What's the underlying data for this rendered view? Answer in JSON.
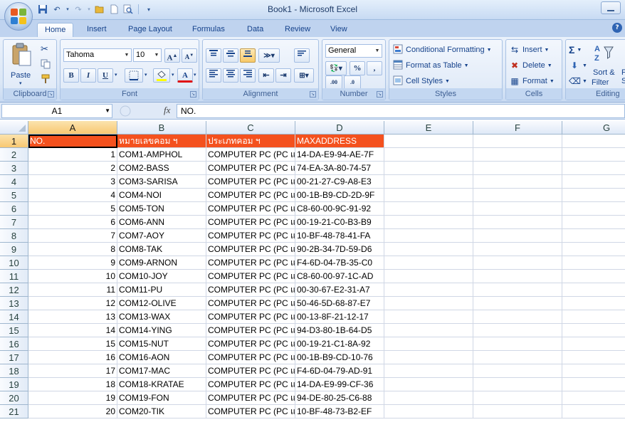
{
  "window": {
    "title": "Book1 - Microsoft Excel"
  },
  "qat": {
    "icons": [
      "save-icon",
      "undo-icon",
      "redo-icon",
      "open-icon",
      "new-icon",
      "print-preview-icon"
    ]
  },
  "tabs": [
    "Home",
    "Insert",
    "Page Layout",
    "Formulas",
    "Data",
    "Review",
    "View"
  ],
  "help": "?",
  "ribbon": {
    "clipboard": {
      "label": "Clipboard",
      "paste": "Paste"
    },
    "font": {
      "label": "Font",
      "name": "Tahoma",
      "size": "10",
      "bold": "B",
      "italic": "I",
      "underline": "U",
      "grow": "A",
      "shrink": "A",
      "font_color_letter": "A"
    },
    "alignment": {
      "label": "Alignment"
    },
    "number": {
      "label": "Number",
      "format": "General",
      "percent": "%",
      "comma": ",",
      "inc_decimal": ".00",
      "dec_decimal": ".0"
    },
    "styles": {
      "label": "Styles",
      "conditional": "Conditional Formatting",
      "format_table": "Format as Table",
      "cell_styles": "Cell Styles"
    },
    "cells": {
      "label": "Cells",
      "insert": "Insert",
      "delete": "Delete",
      "format": "Format"
    },
    "editing": {
      "label": "Editing",
      "sum": "Σ",
      "sort_filter": "Sort &",
      "sort_filter2": "Filter",
      "find": "F",
      "find2": "S"
    }
  },
  "formula_bar": {
    "name_box": "A1",
    "fx": "fx",
    "value": "NO."
  },
  "sheet": {
    "columns": [
      "A",
      "B",
      "C",
      "D",
      "E",
      "F",
      "G"
    ],
    "row_numbers": [
      "1",
      "2",
      "3",
      "4",
      "5",
      "6",
      "7",
      "8",
      "9",
      "10",
      "11",
      "12",
      "13",
      "14",
      "15",
      "16",
      "17",
      "18",
      "19",
      "20",
      "21"
    ],
    "header_row": [
      "NO.",
      "หมายเลขคอม ฯ",
      "ประเภทคอม ฯ",
      "MAXADDRESS"
    ],
    "rows": [
      [
        "1",
        "COM1-AMPHOL",
        "COMPUTER PC (PC แ",
        "14-DA-E9-94-AE-7F"
      ],
      [
        "2",
        "COM2-BASS",
        "COMPUTER PC (PC แ",
        "74-EA-3A-80-74-57"
      ],
      [
        "3",
        "COM3-SARISA",
        "COMPUTER PC (PC แ",
        "00-21-27-C9-A8-E3"
      ],
      [
        "4",
        "COM4-NOI",
        "COMPUTER PC (PC แ",
        "00-1B-B9-CD-2D-9F"
      ],
      [
        "5",
        "COM5-TON",
        "COMPUTER PC (PC แ",
        "C8-60-00-9C-91-92"
      ],
      [
        "6",
        "COM6-ANN",
        "COMPUTER PC (PC แ",
        "00-19-21-C0-B3-B9"
      ],
      [
        "7",
        "COM7-AOY",
        "COMPUTER PC (PC แ",
        "10-BF-48-78-41-FA"
      ],
      [
        "8",
        "COM8-TAK",
        "COMPUTER PC (PC แ",
        "90-2B-34-7D-59-D6"
      ],
      [
        "9",
        "COM9-ARNON",
        "COMPUTER PC (PC แ",
        "F4-6D-04-7B-35-C0"
      ],
      [
        "10",
        "COM10-JOY",
        "COMPUTER PC (PC แ",
        "C8-60-00-97-1C-AD"
      ],
      [
        "11",
        "COM11-PU",
        "COMPUTER PC (PC แ",
        "00-30-67-E2-31-A7"
      ],
      [
        "12",
        "COM12-OLIVE",
        "COMPUTER PC (PC แ",
        "50-46-5D-68-87-E7"
      ],
      [
        "13",
        "COM13-WAX",
        "COMPUTER PC (PC แ",
        "00-13-8F-21-12-17"
      ],
      [
        "14",
        "COM14-YING",
        "COMPUTER PC (PC แ",
        "94-D3-80-1B-64-D5"
      ],
      [
        "15",
        "COM15-NUT",
        "COMPUTER PC (PC แ",
        "00-19-21-C1-8A-92"
      ],
      [
        "16",
        "COM16-AON",
        "COMPUTER PC (PC แ",
        "00-1B-B9-CD-10-76"
      ],
      [
        "17",
        "COM17-MAC",
        "COMPUTER PC (PC แ",
        "F4-6D-04-79-AD-91"
      ],
      [
        "18",
        "COM18-KRATAE",
        "COMPUTER PC (PC แ",
        "14-DA-E9-99-CF-36"
      ],
      [
        "19",
        "COM19-FON",
        "COMPUTER PC (PC แ",
        "94-DE-80-25-C6-88"
      ],
      [
        "20",
        "COM20-TIK",
        "COMPUTER PC (PC แ",
        "10-BF-48-73-B2-EF"
      ]
    ],
    "header_fill": "#f4511e",
    "selection_highlight": "#f8c872"
  }
}
